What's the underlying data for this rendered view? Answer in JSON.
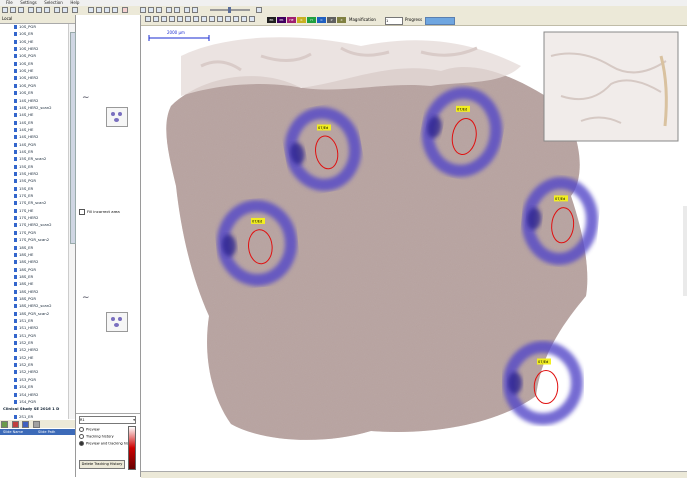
{
  "menu": [
    "File",
    "Settings",
    "Selection",
    "Help"
  ],
  "left_panel": {
    "tab_label": "Local",
    "tree_items": [
      "10S_PGR",
      "10S_ER",
      "10S_HE",
      "10S_HER2",
      "10S_PGR",
      "10S_ER",
      "10S_HE",
      "10S_HER2",
      "10S_PGR",
      "10S_ER",
      "14S_HER2",
      "14S_HER2_scan2",
      "14S_HE",
      "14S_ER",
      "14S_HE",
      "14S_HER2",
      "14S_PGR",
      "14S_ER",
      "15S_ER_scan2",
      "15S_ER",
      "15S_HER2",
      "15S_PGR",
      "15S_ER",
      "17S_ER",
      "17S_ER_scan2",
      "17S_HE",
      "17S_HER2",
      "17S_HER2_scan2",
      "17S_PGR",
      "17S_PGR_scan2",
      "18S_ER",
      "18S_HE",
      "18S_HER2",
      "18S_PGR",
      "18S_ER",
      "18S_HE",
      "18S_HER2",
      "18S_PGR",
      "18S_HER2_scan2",
      "18S_PGR_scan2",
      "1S1_ER",
      "1S1_HER2",
      "1S1_PGR",
      "1S2_ER",
      "1S2_HER2",
      "1S2_HE",
      "1S2_ER",
      "1S2_HER2",
      "1S3_PGR",
      "1S4_ER",
      "1S4_HER2",
      "1S4_PGR"
    ],
    "tree_parent": "Clinical Study SE 2016 1 D",
    "tree_tail": [
      "2S1_ER",
      "2S1_HER2"
    ],
    "table_headers": [
      "Slide Name",
      "Slide Path"
    ]
  },
  "middle_panel": {
    "checkbox_label": "Fill incorrect area",
    "select_value": "R1",
    "radios": [
      "Preview",
      "Tracking history",
      "Preview and tracking history"
    ],
    "delete_button": "Delete Tracking History"
  },
  "viewer_toolbar": {
    "magnification_label": "Magnification",
    "magnification_value": "1",
    "progress_label": "Progress",
    "progress_fraction": 1.0,
    "chips": [
      {
        "label": "ER",
        "color": "#202020"
      },
      {
        "label": "PR",
        "color": "#400060"
      },
      {
        "label": "HE",
        "color": "#a02070"
      },
      {
        "label": "K",
        "color": "#c8b020"
      },
      {
        "label": "H",
        "color": "#20a040"
      },
      {
        "label": "C",
        "color": "#2060c0"
      },
      {
        "label": "P",
        "color": "#606060"
      },
      {
        "label": "X",
        "color": "#808040"
      }
    ]
  },
  "viewer": {
    "scale_label": "2000 µm",
    "tissue_color": "#b7a6a3",
    "region_color": "#5247c8",
    "annotation_tags": [
      "07/Ed",
      "07/Ed",
      "07/Ed",
      "07/Ed",
      "07/Ed"
    ]
  }
}
